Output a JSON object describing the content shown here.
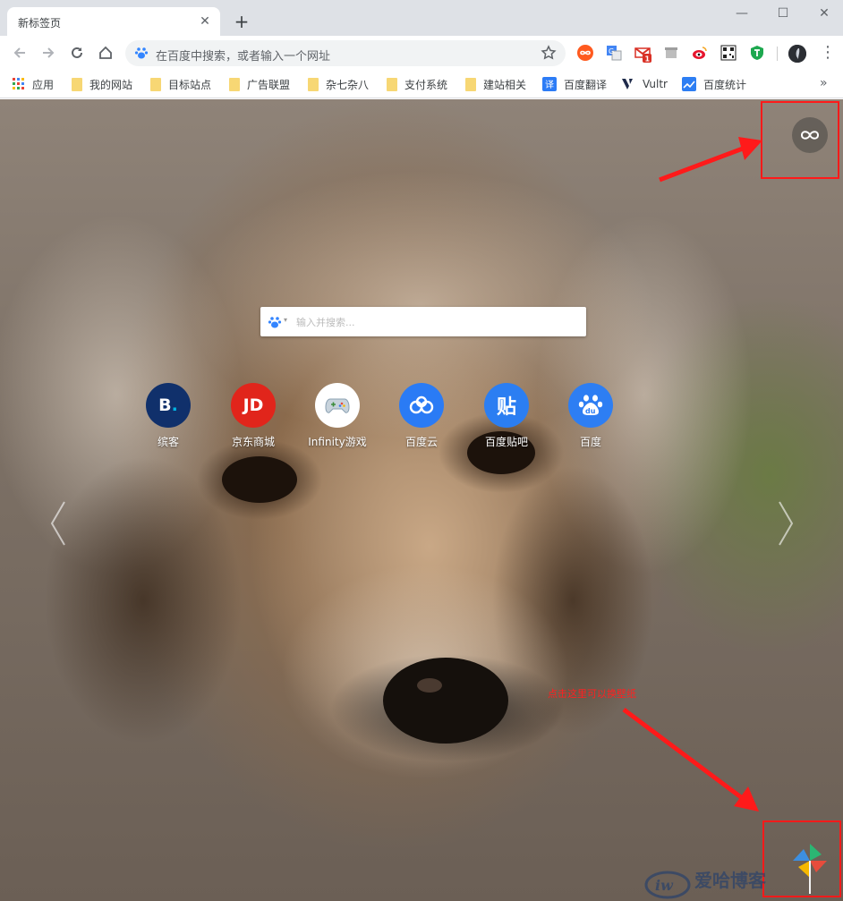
{
  "tabs": [
    {
      "title": "新标签页"
    }
  ],
  "window": {
    "minimize": "—",
    "maximize": "☐",
    "close": "✕"
  },
  "omnibox": {
    "placeholder": "在百度中搜索，或者输入一个网址"
  },
  "extensions": [
    "infinity-icon",
    "translate-icon",
    "gmail-icon",
    "store-icon",
    "weibo-icon",
    "qrcode-icon",
    "shield-icon"
  ],
  "gmail_badge": "1",
  "bookmarks": {
    "apps": "应用",
    "items": [
      {
        "label": "我的网站",
        "type": "folder"
      },
      {
        "label": "目标站点",
        "type": "folder"
      },
      {
        "label": "广告联盟",
        "type": "folder"
      },
      {
        "label": "杂七杂八",
        "type": "folder"
      },
      {
        "label": "支付系统",
        "type": "folder"
      },
      {
        "label": "建站相关",
        "type": "folder"
      },
      {
        "label": "百度翻译",
        "type": "link"
      },
      {
        "label": "Vultr",
        "type": "link"
      },
      {
        "label": "百度统计",
        "type": "link"
      }
    ],
    "more": "»"
  },
  "newtab": {
    "search": {
      "placeholder": "输入并搜索..."
    },
    "tiles": [
      {
        "label": "缤客",
        "glyph": "B.",
        "color": "#10306b"
      },
      {
        "label": "京东商城",
        "glyph": "JD",
        "color": "#e1251b"
      },
      {
        "label": "Infinity游戏",
        "glyph": "🎮",
        "color": "#ffffff"
      },
      {
        "label": "百度云",
        "glyph": "☁",
        "color": "#2a7bf5"
      },
      {
        "label": "百度贴吧",
        "glyph": "贴",
        "color": "#2b7ef2"
      },
      {
        "label": "百度",
        "glyph": "du",
        "color": "#2d7ef3"
      }
    ],
    "annotation": "点击这里可以换壁纸",
    "watermark": "爱哈博客"
  },
  "colors": {
    "annotation_red": "#ff1a1a",
    "tab_strip": "#dee1e6"
  }
}
